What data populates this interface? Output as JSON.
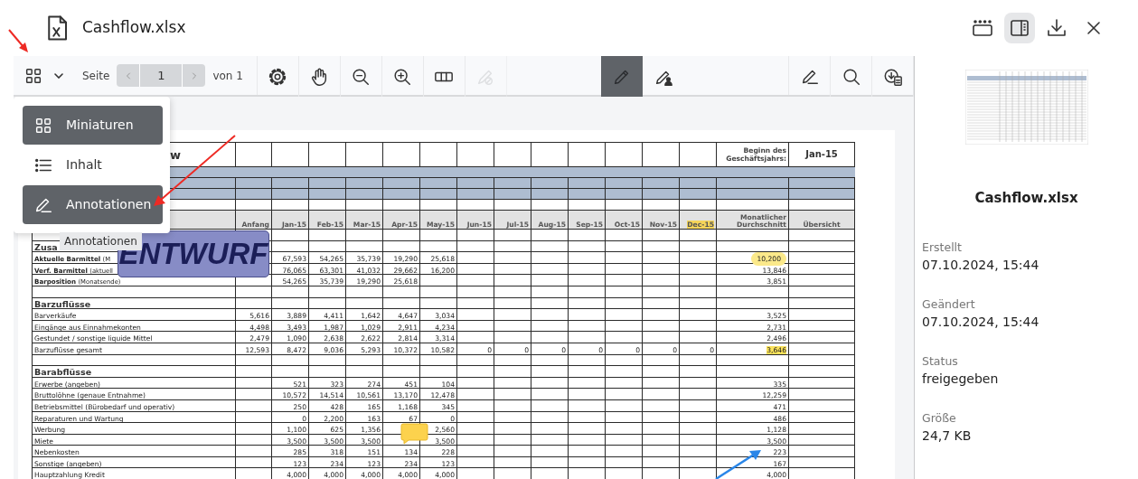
{
  "header": {
    "title": "Cashflow.xlsx",
    "buttons": [
      {
        "selected": false
      },
      {
        "selected": true
      },
      {
        "selected": false
      },
      {
        "selected": false
      }
    ]
  },
  "toolbar": {
    "page_label": "Seite",
    "page": "1",
    "page_total": "von 1",
    "tools": [
      {
        "active": false,
        "disabled": false
      },
      {
        "active": false,
        "disabled": false
      },
      {
        "active": false,
        "disabled": false
      },
      {
        "active": false,
        "disabled": false
      },
      {
        "active": false,
        "disabled": false
      },
      {
        "active": false,
        "disabled": true
      },
      {
        "active": true,
        "disabled": false
      },
      {
        "active": false,
        "disabled": false
      },
      {
        "active": false,
        "disabled": false
      },
      {
        "active": false,
        "disabled": false
      },
      {
        "active": false,
        "disabled": false
      }
    ]
  },
  "menu": {
    "items": [
      {
        "label": "Miniaturen",
        "highlighted": true
      },
      {
        "label": "Inhalt",
        "highlighted": false
      },
      {
        "label": "Annotationen",
        "highlighted": true
      }
    ],
    "tooltip": "Annotationen"
  },
  "document": {
    "stamp": "ENTWURF",
    "table": {
      "title": "w",
      "fiscal_start_label": "Beginn des Geschäftsjahrs:",
      "fiscal_start": "Jan-15",
      "columns": [
        {
          "label": "Anfang",
          "highlighted": false
        },
        {
          "label": "Jan-15",
          "highlighted": false
        },
        {
          "label": "Feb-15",
          "highlighted": false
        },
        {
          "label": "Mar-15",
          "highlighted": false
        },
        {
          "label": "Apr-15",
          "highlighted": false
        },
        {
          "label": "May-15",
          "highlighted": false
        },
        {
          "label": "Jun-15",
          "highlighted": false
        },
        {
          "label": "Jul-15",
          "highlighted": false
        },
        {
          "label": "Aug-15",
          "highlighted": false
        },
        {
          "label": "Sep-15",
          "highlighted": false
        },
        {
          "label": "Oct-15",
          "highlighted": false
        },
        {
          "label": "Nov-15",
          "highlighted": false
        },
        {
          "label": "Dec-15",
          "highlighted": true
        },
        {
          "label": "Monatlicher Durchschnitt",
          "highlighted": false
        },
        {
          "label": "Übersicht",
          "highlighted": false
        }
      ],
      "rows": [
        {
          "kind": "blank"
        },
        {
          "kind": "section",
          "label": "Zusa"
        },
        {
          "kind": "summary",
          "label": "Aktuelle Barmittel",
          "note": "(M",
          "cells": {
            "jan": "67,593",
            "feb": "54,265",
            "mar": "35,739",
            "apr": "19,290",
            "may": "25,618",
            "average": "10,200"
          },
          "average_circled": true,
          "average_marked": false
        },
        {
          "kind": "summary",
          "label": "Verf. Barmittel",
          "note": "(aktuell",
          "cells": {
            "jan": "76,065",
            "feb": "63,301",
            "mar": "41,032",
            "apr": "29,662",
            "may": "16,200",
            "average": "13,846"
          },
          "average_circled": false,
          "average_marked": false
        },
        {
          "kind": "summary",
          "label": "Barposition",
          "note": "(Monatsende)",
          "cells": {
            "jan": "54,265",
            "feb": "35,739",
            "mar": "19,290",
            "apr": "25,618",
            "average": "3,851"
          },
          "average_circled": false,
          "average_marked": false
        },
        {
          "kind": "blank"
        },
        {
          "kind": "section",
          "label": "Barzuflüsse"
        },
        {
          "kind": "data",
          "label": "Barverkäufe",
          "cells": {
            "start": "5,616",
            "jan": "3,889",
            "feb": "4,411",
            "mar": "1,642",
            "apr": "4,647",
            "may": "3,034",
            "average": "3,525"
          },
          "average_circled": false,
          "average_marked": false
        },
        {
          "kind": "data",
          "label": "Eingänge aus Einnahmekonten",
          "cells": {
            "start": "4,498",
            "jan": "3,493",
            "feb": "1,987",
            "mar": "1,029",
            "apr": "2,911",
            "may": "4,234",
            "average": "2,731"
          },
          "average_circled": false,
          "average_marked": false
        },
        {
          "kind": "data",
          "label": "Gestundet / sonstige liquide Mittel",
          "cells": {
            "start": "2,479",
            "jan": "1,090",
            "feb": "2,638",
            "mar": "2,622",
            "apr": "2,814",
            "may": "3,314",
            "average": "2,496"
          },
          "average_circled": false,
          "average_marked": false
        },
        {
          "kind": "data",
          "label": "Barzuflüsse gesamt",
          "cells": {
            "start": "12,593",
            "jan": "8,472",
            "feb": "9,036",
            "mar": "5,293",
            "apr": "10,372",
            "may": "10,582",
            "jun": "0",
            "jul": "0",
            "aug": "0",
            "sep": "0",
            "oct": "0",
            "nov": "0",
            "dec": "0",
            "average": "3,646"
          },
          "average_circled": false,
          "average_marked": true
        },
        {
          "kind": "blank"
        },
        {
          "kind": "section",
          "label": "Barabflüsse"
        },
        {
          "kind": "data",
          "label": "Erwerbe (angeben)",
          "cells": {
            "jan": "521",
            "feb": "323",
            "mar": "274",
            "apr": "451",
            "may": "104",
            "average": "335"
          },
          "average_circled": false,
          "average_marked": false
        },
        {
          "kind": "data",
          "label": "Bruttolöhne (genaue Entnahme)",
          "cells": {
            "jan": "10,572",
            "feb": "14,514",
            "mar": "10,561",
            "apr": "13,170",
            "may": "12,478",
            "average": "12,259"
          },
          "average_circled": false,
          "average_marked": false
        },
        {
          "kind": "data",
          "label": "Betriebsmittel (Bürobedarf und operativ)",
          "cells": {
            "jan": "250",
            "feb": "428",
            "mar": "165",
            "apr": "1,168",
            "may": "345",
            "average": "471"
          },
          "average_circled": false,
          "average_marked": false
        },
        {
          "kind": "data",
          "label": "Reparaturen und Wartung",
          "cells": {
            "jan": "0",
            "feb": "2,200",
            "mar": "163",
            "apr": "67",
            "may": "0",
            "average": "486"
          },
          "average_circled": false,
          "average_marked": false
        },
        {
          "kind": "data",
          "label": "Werbung",
          "cells": {
            "jan": "1,100",
            "feb": "625",
            "mar": "1,356",
            "may": "2,560",
            "average": "1,128"
          },
          "average_circled": false,
          "average_marked": false
        },
        {
          "kind": "data",
          "label": "Miete",
          "cells": {
            "jan": "3,500",
            "feb": "3,500",
            "mar": "3,500",
            "may": "3,500",
            "average": "3,500"
          },
          "average_circled": false,
          "average_marked": false
        },
        {
          "kind": "data",
          "label": "Nebenkosten",
          "cells": {
            "jan": "285",
            "feb": "318",
            "mar": "151",
            "apr": "134",
            "may": "228",
            "average": "223"
          },
          "average_circled": false,
          "average_marked": false
        },
        {
          "kind": "data",
          "label": "Sonstige (angeben)",
          "cells": {
            "jan": "123",
            "feb": "234",
            "mar": "123",
            "apr": "234",
            "may": "123",
            "average": "167"
          },
          "average_circled": false,
          "average_marked": false
        },
        {
          "kind": "data",
          "label": "Hauptzahlung Kredit",
          "cells": {
            "jan": "4,000",
            "feb": "4,000",
            "mar": "4,000",
            "apr": "4,000",
            "may": "4,000",
            "average": "4,000"
          },
          "average_circled": false,
          "average_marked": false
        }
      ]
    }
  },
  "sidebar": {
    "title": "Cashflow.xlsx",
    "properties": [
      {
        "label": "Erstellt",
        "value": "07.10.2024, 15:44"
      },
      {
        "label": "Geändert",
        "value": "07.10.2024, 15:44"
      },
      {
        "label": "Status",
        "value": "freigegeben"
      },
      {
        "label": "Größe",
        "value": "24,7 KB"
      }
    ]
  }
}
